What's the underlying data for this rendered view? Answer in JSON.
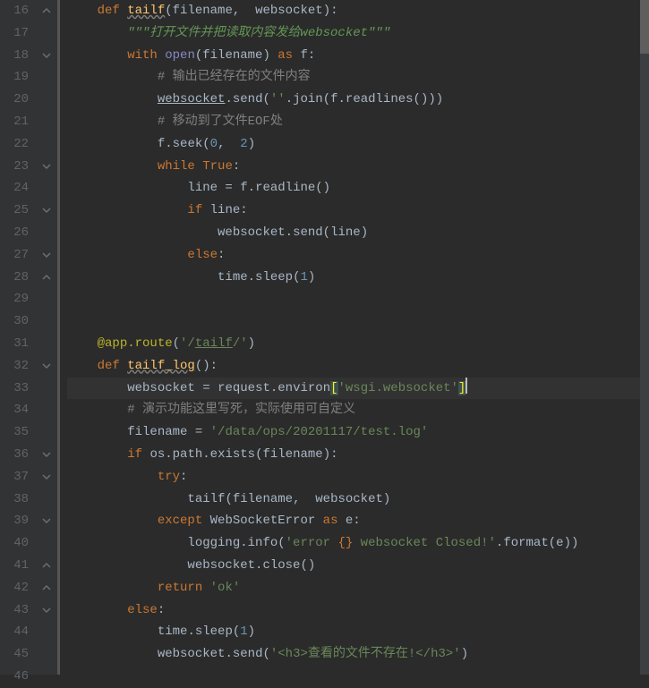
{
  "lines": [
    {
      "n": 16,
      "fold": "up",
      "html": "<span class='kw'>def </span><span class='fn-u' data-name='fn-tailf'>tailf</span><span class='pn'>(</span><span class='ident'>filename</span><span class='op'>, </span><span class='ident'> websocket</span><span class='pn'>)</span><span class='op'>:</span>"
    },
    {
      "n": 17,
      "fold": null,
      "indent": 1,
      "html": "<span class='doc'>&quot;&quot;&quot;打开文件并把读取内容发给websocket&quot;&quot;&quot;</span>"
    },
    {
      "n": 18,
      "fold": "down",
      "indent": 1,
      "html": "<span class='kw'>with </span><span class='builtin'>open</span><span class='pn'>(</span><span class='ident'>filename</span><span class='pn'>)</span><span class='kw'> as </span><span class='ident'>f</span><span class='op'>:</span>"
    },
    {
      "n": 19,
      "fold": null,
      "indent": 2,
      "html": "<span class='cm'># 输出已经存在的文件内容</span>"
    },
    {
      "n": 20,
      "fold": null,
      "indent": 2,
      "html": "<span class='u' data-name='ref-websocket'>websocket</span><span class='op'>.</span><span class='ident'>send</span><span class='pn'>(</span><span class='str'>''</span><span class='op'>.</span><span class='ident'>join</span><span class='pn'>(</span><span class='ident'>f</span><span class='op'>.</span><span class='ident'>readlines</span><span class='pn'>()))</span>"
    },
    {
      "n": 21,
      "fold": null,
      "indent": 2,
      "html": "<span class='cm'># 移动到了文件EOF处</span>"
    },
    {
      "n": 22,
      "fold": null,
      "indent": 2,
      "html": "<span class='ident'>f</span><span class='op'>.</span><span class='ident'>seek</span><span class='pn'>(</span><span class='num'>0</span><span class='op'>, </span><span class='num'> 2</span><span class='pn'>)</span>"
    },
    {
      "n": 23,
      "fold": "down",
      "indent": 2,
      "html": "<span class='kw'>while </span><span class='kw'>True</span><span class='op'>:</span>"
    },
    {
      "n": 24,
      "fold": null,
      "indent": 3,
      "html": "<span class='ident'>line</span><span class='op'> = </span><span class='ident'>f</span><span class='op'>.</span><span class='ident'>readline</span><span class='pn'>()</span>"
    },
    {
      "n": 25,
      "fold": "down",
      "indent": 3,
      "html": "<span class='kw'>if </span><span class='ident'>line</span><span class='op'>:</span>"
    },
    {
      "n": 26,
      "fold": null,
      "indent": 4,
      "html": "<span class='ident'>websocket</span><span class='op'>.</span><span class='ident'>send</span><span class='pn'>(</span><span class='ident'>line</span><span class='pn'>)</span>"
    },
    {
      "n": 27,
      "fold": "down",
      "indent": 3,
      "html": "<span class='kw'>else</span><span class='op'>:</span>"
    },
    {
      "n": 28,
      "fold": "up",
      "indent": 4,
      "html": "<span class='ident'>time</span><span class='op'>.</span><span class='ident'>sleep</span><span class='pn'>(</span><span class='num'>1</span><span class='pn'>)</span>"
    },
    {
      "n": 29,
      "fold": null,
      "indent": 0,
      "html": ""
    },
    {
      "n": 30,
      "fold": null,
      "indent": 0,
      "html": ""
    },
    {
      "n": 31,
      "fold": null,
      "indent": 0,
      "html": "<span class='dec'>@app.route</span><span class='pn'>(</span><span class='str'>'/</span><span class='str' style='text-decoration:underline'>tailf</span><span class='str'>/'</span><span class='pn'>)</span>"
    },
    {
      "n": 32,
      "fold": "down",
      "indent": 0,
      "html": "<span class='kw'>def </span><span class='fn-u' data-name='fn-tailf-log'>tailf_log</span><span class='pn'>()</span><span class='op'>:</span>"
    },
    {
      "n": 33,
      "fold": null,
      "indent": 1,
      "hl": true,
      "html": "<span class='ident'>websocket</span><span class='op'> = </span><span class='ident'>request</span><span class='op'>.</span><span class='ident'>environ</span><span class='bracket-hl'>[</span><span class='str'>'wsgi.websocket'</span><span class='bracket-hl'>]</span><span class='cursor' data-name='text-cursor'></span>"
    },
    {
      "n": 34,
      "fold": null,
      "indent": 1,
      "html": "<span class='cm'># 演示功能这里写死，实际使用可自定义</span>"
    },
    {
      "n": 35,
      "fold": null,
      "indent": 1,
      "html": "<span class='ident'>filename</span><span class='op'> = </span><span class='str'>'/data/ops/20201117/test.log'</span>"
    },
    {
      "n": 36,
      "fold": "down",
      "indent": 1,
      "html": "<span class='kw'>if </span><span class='ident'>os</span><span class='op'>.</span><span class='ident'>path</span><span class='op'>.</span><span class='ident'>exists</span><span class='pn'>(</span><span class='ident'>filename</span><span class='pn'>)</span><span class='op'>:</span>"
    },
    {
      "n": 37,
      "fold": "down",
      "indent": 2,
      "html": "<span class='kw'>try</span><span class='op'>:</span>"
    },
    {
      "n": 38,
      "fold": null,
      "indent": 3,
      "html": "<span class='ident'>tailf</span><span class='pn'>(</span><span class='ident'>filename</span><span class='op'>, </span><span class='ident'> websocket</span><span class='pn'>)</span>"
    },
    {
      "n": 39,
      "fold": "down",
      "indent": 2,
      "html": "<span class='kw'>except </span><span class='ident'>WebSocketError</span><span class='kw'> as </span><span class='ident'>e</span><span class='op'>:</span>"
    },
    {
      "n": 40,
      "fold": null,
      "indent": 3,
      "html": "<span class='ident'>logging</span><span class='op'>.</span><span class='ident'>info</span><span class='pn'>(</span><span class='str'>'error </span><span class='pn' style='color:#cc7832'>{}</span><span class='str'> websocket Closed!'</span><span class='op'>.</span><span class='ident'>format</span><span class='pn'>(</span><span class='ident'>e</span><span class='pn'>))</span>"
    },
    {
      "n": 41,
      "fold": "up",
      "indent": 3,
      "html": "<span class='ident'>websocket</span><span class='op'>.</span><span class='ident'>close</span><span class='pn'>()</span>"
    },
    {
      "n": 42,
      "fold": "up",
      "indent": 2,
      "html": "<span class='kw'>return </span><span class='str'>'ok'</span>"
    },
    {
      "n": 43,
      "fold": "down",
      "indent": 1,
      "html": "<span class='kw'>else</span><span class='op'>:</span>"
    },
    {
      "n": 44,
      "fold": null,
      "indent": 2,
      "html": "<span class='ident'>time</span><span class='op'>.</span><span class='ident'>sleep</span><span class='pn'>(</span><span class='num'>1</span><span class='pn'>)</span>"
    },
    {
      "n": 45,
      "fold": null,
      "indent": 2,
      "html": "<span class='ident'>websocket</span><span class='op'>.</span><span class='ident'>send</span><span class='pn'>(</span><span class='str'>'&lt;h3&gt;查看的文件不存在!&lt;/h3&gt;'</span><span class='pn'>)</span>"
    },
    {
      "n": 46,
      "fold": null,
      "indent": 0,
      "html": ""
    }
  ],
  "indent_unit": "    ",
  "base_indent": "    "
}
